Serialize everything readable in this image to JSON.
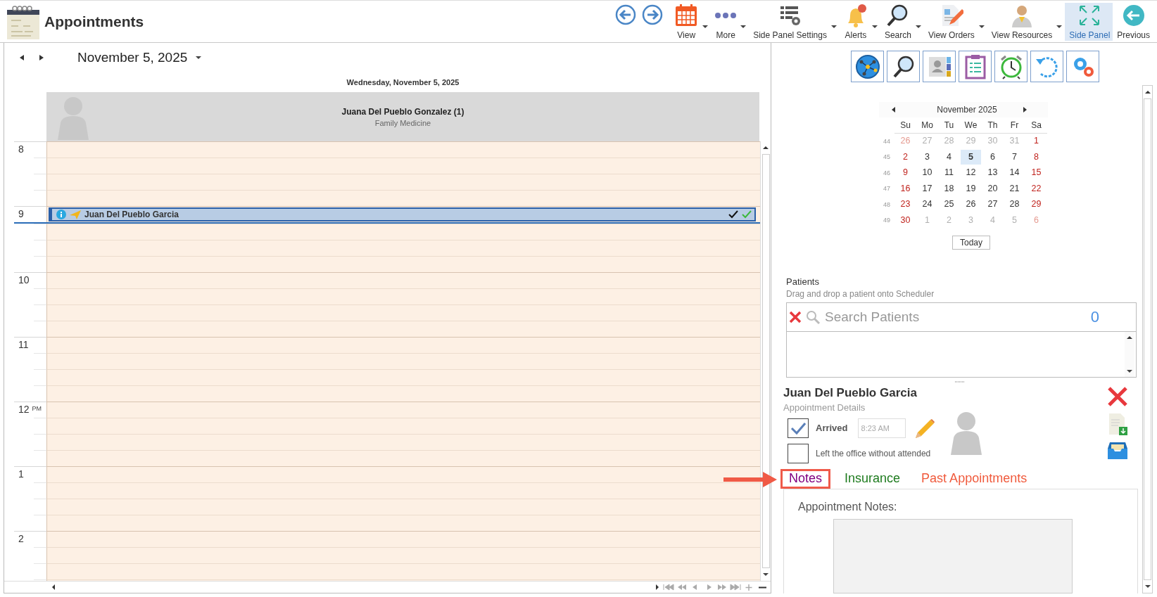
{
  "app": {
    "title": "Appointments"
  },
  "toolbar": [
    {
      "label": "View",
      "dropdown": true,
      "selected": false
    },
    {
      "label": "More",
      "dropdown": true,
      "selected": false
    },
    {
      "label": "Side Panel Settings",
      "dropdown": true,
      "selected": false
    },
    {
      "label": "Alerts",
      "dropdown": true,
      "selected": false
    },
    {
      "label": "Search",
      "dropdown": true,
      "selected": false
    },
    {
      "label": "View Orders",
      "dropdown": true,
      "selected": false
    },
    {
      "label": "View Resources",
      "dropdown": true,
      "selected": false
    },
    {
      "label": "Side Panel",
      "dropdown": false,
      "selected": true
    },
    {
      "label": "Previous",
      "dropdown": false,
      "selected": false
    }
  ],
  "scheduler": {
    "date": "November 5, 2025",
    "day_header": "Wednesday, November 5, 2025",
    "resource": {
      "name": "Juana Del Pueblo Gonzalez (1)",
      "specialty": "Family Medicine"
    },
    "hours": [
      {
        "label": "8",
        "now": false
      },
      {
        "label": "9",
        "now": true,
        "appointment": {
          "patient": "Juan Del Pueblo Garcia"
        }
      },
      {
        "label": "10",
        "now": false
      },
      {
        "label": "11",
        "now": false
      },
      {
        "label": "12",
        "suffix": "PM",
        "now": false
      },
      {
        "label": "1",
        "now": false
      },
      {
        "label": "2",
        "now": false
      }
    ]
  },
  "side_panel": {
    "calendar": {
      "title": "November 2025",
      "weekdays": [
        "Su",
        "Mo",
        "Tu",
        "We",
        "Th",
        "Fr",
        "Sa"
      ],
      "weeks": [
        {
          "number": "44",
          "days": [
            {
              "label": "26",
              "in_month": false,
              "weekend": true,
              "selected": false
            },
            {
              "label": "27",
              "in_month": false,
              "weekend": false,
              "selected": false
            },
            {
              "label": "28",
              "in_month": false,
              "weekend": false,
              "selected": false
            },
            {
              "label": "29",
              "in_month": false,
              "weekend": false,
              "selected": false
            },
            {
              "label": "30",
              "in_month": false,
              "weekend": false,
              "selected": false
            },
            {
              "label": "31",
              "in_month": false,
              "weekend": false,
              "selected": false
            },
            {
              "label": "1",
              "in_month": true,
              "weekend": true,
              "selected": false
            }
          ]
        },
        {
          "number": "45",
          "days": [
            {
              "label": "2",
              "in_month": true,
              "weekend": true,
              "selected": false
            },
            {
              "label": "3",
              "in_month": true,
              "weekend": false,
              "selected": false
            },
            {
              "label": "4",
              "in_month": true,
              "weekend": false,
              "selected": false
            },
            {
              "label": "5",
              "in_month": true,
              "weekend": false,
              "selected": true
            },
            {
              "label": "6",
              "in_month": true,
              "weekend": false,
              "selected": false
            },
            {
              "label": "7",
              "in_month": true,
              "weekend": false,
              "selected": false
            },
            {
              "label": "8",
              "in_month": true,
              "weekend": true,
              "selected": false
            }
          ]
        },
        {
          "number": "46",
          "days": [
            {
              "label": "9",
              "in_month": true,
              "weekend": true,
              "selected": false
            },
            {
              "label": "10",
              "in_month": true,
              "weekend": false,
              "selected": false
            },
            {
              "label": "11",
              "in_month": true,
              "weekend": false,
              "selected": false
            },
            {
              "label": "12",
              "in_month": true,
              "weekend": false,
              "selected": false
            },
            {
              "label": "13",
              "in_month": true,
              "weekend": false,
              "selected": false
            },
            {
              "label": "14",
              "in_month": true,
              "weekend": false,
              "selected": false
            },
            {
              "label": "15",
              "in_month": true,
              "weekend": true,
              "selected": false
            }
          ]
        },
        {
          "number": "47",
          "days": [
            {
              "label": "16",
              "in_month": true,
              "weekend": true,
              "selected": false
            },
            {
              "label": "17",
              "in_month": true,
              "weekend": false,
              "selected": false
            },
            {
              "label": "18",
              "in_month": true,
              "weekend": false,
              "selected": false
            },
            {
              "label": "19",
              "in_month": true,
              "weekend": false,
              "selected": false
            },
            {
              "label": "20",
              "in_month": true,
              "weekend": false,
              "selected": false
            },
            {
              "label": "21",
              "in_month": true,
              "weekend": false,
              "selected": false
            },
            {
              "label": "22",
              "in_month": true,
              "weekend": true,
              "selected": false
            }
          ]
        },
        {
          "number": "48",
          "days": [
            {
              "label": "23",
              "in_month": true,
              "weekend": true,
              "selected": false
            },
            {
              "label": "24",
              "in_month": true,
              "weekend": false,
              "selected": false
            },
            {
              "label": "25",
              "in_month": true,
              "weekend": false,
              "selected": false
            },
            {
              "label": "26",
              "in_month": true,
              "weekend": false,
              "selected": false
            },
            {
              "label": "27",
              "in_month": true,
              "weekend": false,
              "selected": false
            },
            {
              "label": "28",
              "in_month": true,
              "weekend": false,
              "selected": false
            },
            {
              "label": "29",
              "in_month": true,
              "weekend": true,
              "selected": false
            }
          ]
        },
        {
          "number": "49",
          "days": [
            {
              "label": "30",
              "in_month": true,
              "weekend": true,
              "selected": false
            },
            {
              "label": "1",
              "in_month": false,
              "weekend": false,
              "selected": false
            },
            {
              "label": "2",
              "in_month": false,
              "weekend": false,
              "selected": false
            },
            {
              "label": "3",
              "in_month": false,
              "weekend": false,
              "selected": false
            },
            {
              "label": "4",
              "in_month": false,
              "weekend": false,
              "selected": false
            },
            {
              "label": "5",
              "in_month": false,
              "weekend": false,
              "selected": false
            },
            {
              "label": "6",
              "in_month": false,
              "weekend": true,
              "selected": false
            }
          ]
        }
      ],
      "today_button": "Today"
    },
    "patients": {
      "title": "Patients",
      "hint": "Drag and drop a patient onto Scheduler",
      "search": {
        "placeholder": "Search Patients"
      },
      "count": "0"
    },
    "details": {
      "name": "Juan Del Pueblo Garcia",
      "subtitle": "Appointment Details",
      "arrived": {
        "label": "Arrived",
        "checked": true,
        "time": "8:23 AM"
      },
      "left_office": {
        "label": "Left the office without attended",
        "checked": false
      },
      "tabs": [
        {
          "label": "Notes",
          "selected": true,
          "color": "#800080"
        },
        {
          "label": "Insurance",
          "selected": false,
          "color": "#1e7b1e"
        },
        {
          "label": "Past Appointments",
          "selected": false,
          "color": "#f05a3c"
        }
      ],
      "notes": {
        "label": "Appointment Notes:"
      }
    }
  }
}
